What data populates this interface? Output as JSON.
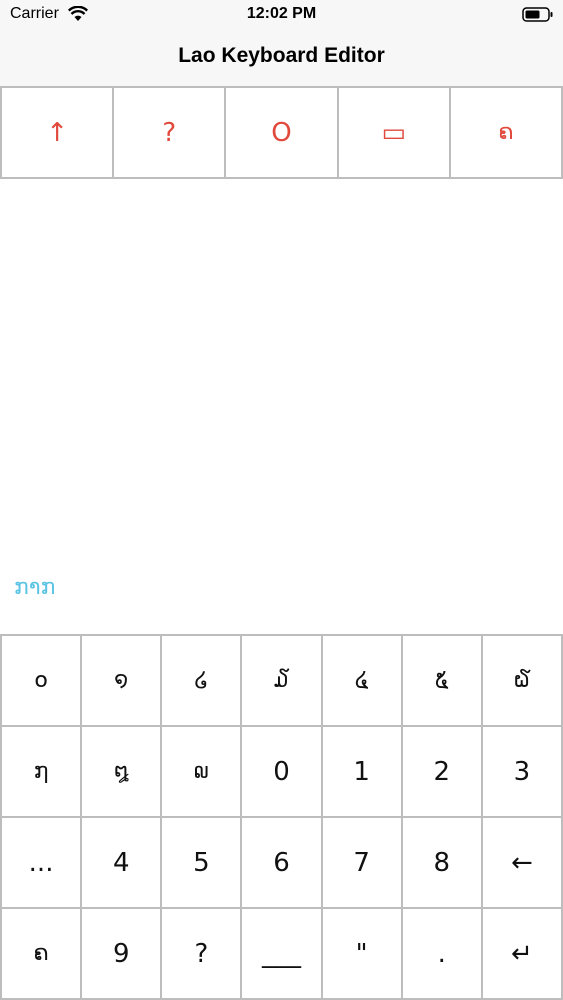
{
  "status": {
    "carrier": "Carrier",
    "time": "12:02 PM",
    "wifi_icon": "wifi-icon",
    "battery_icon": "battery-icon"
  },
  "nav": {
    "title": "Lao Keyboard Editor"
  },
  "toolbar": {
    "color": "#e0493c",
    "buttons": [
      {
        "label": "↑",
        "icon": "up-arrow-icon"
      },
      {
        "label": "?",
        "icon": "question-icon"
      },
      {
        "label": "O",
        "icon": "circle-icon"
      },
      {
        "label": "▭",
        "icon": "rectangle-icon"
      },
      {
        "label": "ຄ",
        "icon": "lao-char-icon"
      }
    ]
  },
  "editor": {
    "text": "ກາກ",
    "text_color": "#5bc4e4"
  },
  "keyboard": {
    "rows": [
      [
        "໐",
        "໑",
        "໒",
        "໓",
        "໔",
        "໕",
        "໖"
      ],
      [
        "໗",
        "໘",
        "໙",
        "0",
        "1",
        "2",
        "3"
      ],
      [
        "...",
        "4",
        "5",
        "6",
        "7",
        "8",
        "←"
      ],
      [
        "ຄ",
        "9",
        "?",
        "___",
        "\"",
        ".",
        "↵"
      ]
    ]
  }
}
